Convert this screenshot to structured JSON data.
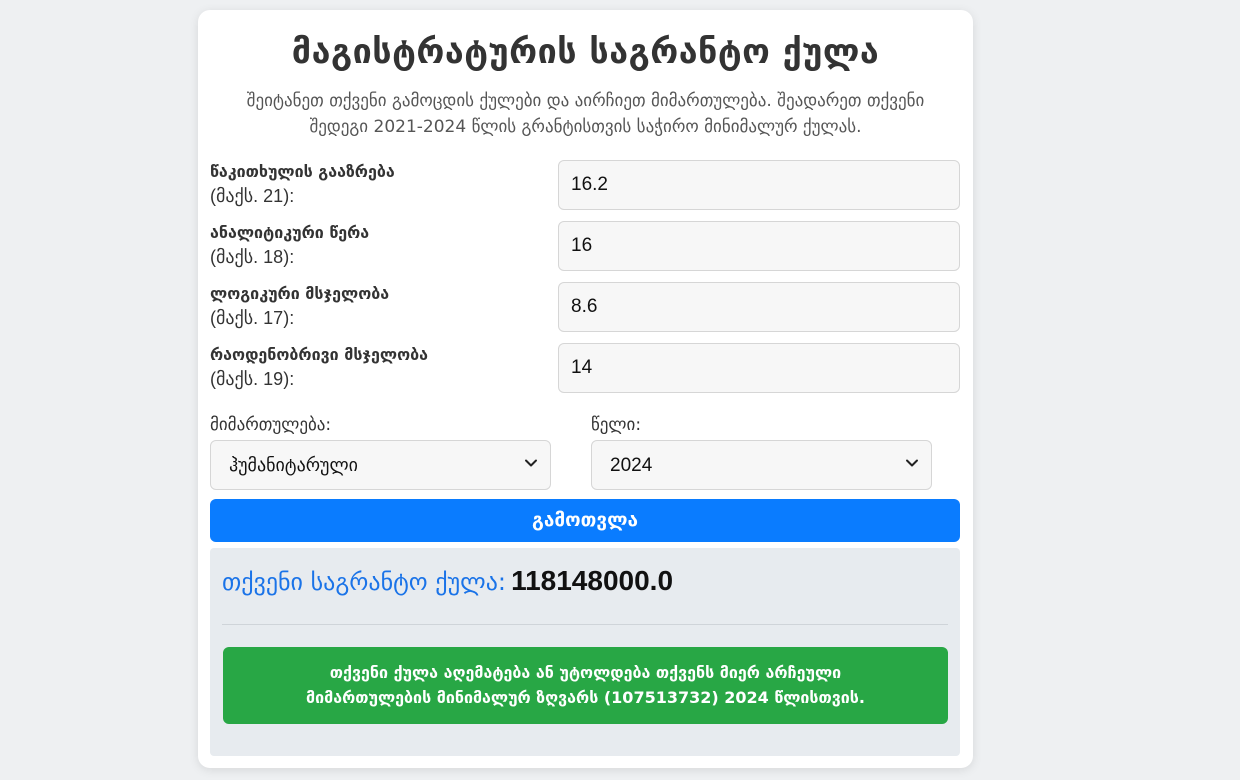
{
  "page": {
    "title": "მაგისტრატურის საგრანტო ქულა",
    "subtitle": "შეიტანეთ თქვენი გამოცდის ქულები და აირჩიეთ მიმართულება. შეადარეთ თქვენი შედეგი 2021-2024 წლის გრანტისთვის საჭირო მინიმალურ ქულას."
  },
  "form": {
    "scores": [
      {
        "label": "წაკითხულის გააზრება",
        "max": "(მაქს. 21):",
        "value": "16.2"
      },
      {
        "label": "ანალიტიკური წერა",
        "max": "(მაქს. 18):",
        "value": "16"
      },
      {
        "label": "ლოგიკური მსჯელობა",
        "max": "(მაქს. 17):",
        "value": "8.6"
      },
      {
        "label": "რაოდენობრივი მსჯელობა",
        "max": "(მაქს. 19):",
        "value": "14"
      }
    ],
    "direction": {
      "label": "მიმართულება:",
      "selected": "ჰუმანიტარული"
    },
    "year": {
      "label": "წელი:",
      "selected": "2024"
    },
    "calculate_button": "გამოთვლა"
  },
  "result": {
    "label": "თქვენი საგრანტო ქულა:",
    "value": "118148000.0",
    "message_line1": "თქვენი ქულა აღემატება ან უტოლდება თქვენს მიერ არჩეული",
    "message_line2": "მიმართულების მინიმალურ ზღვარს (107513732) 2024 წლისთვის.",
    "status_color": "#28a745",
    "accent_color": "#0a7cff"
  },
  "icons": {
    "select_arrow": "chevron-down-icon"
  }
}
